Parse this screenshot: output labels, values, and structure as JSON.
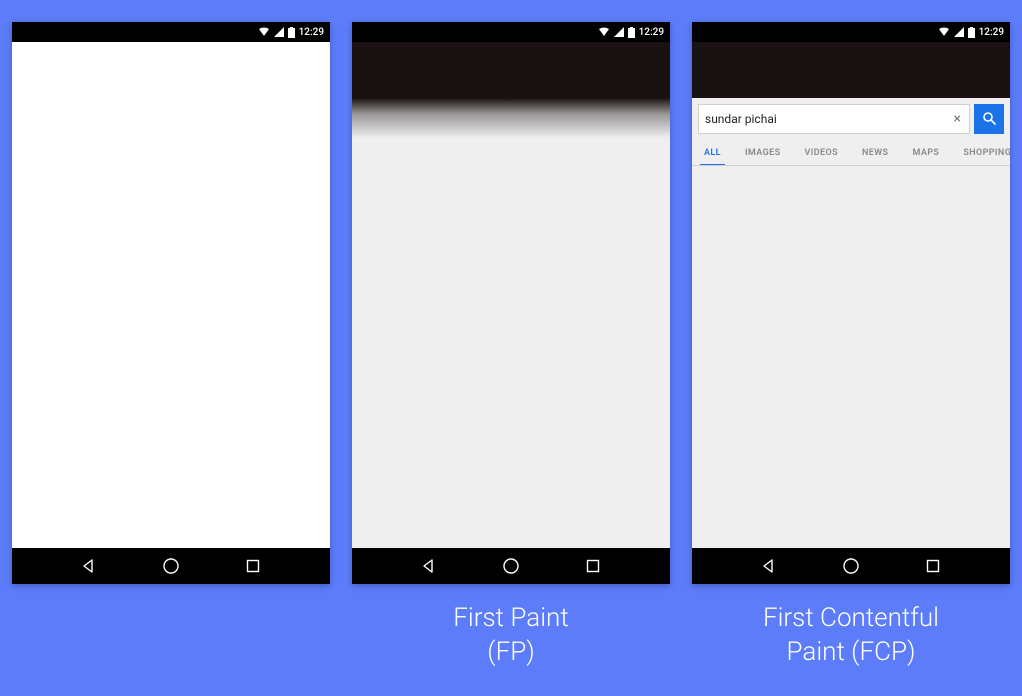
{
  "status_bar": {
    "time": "12:29"
  },
  "captions": {
    "blank": "",
    "fp_line1": "First Paint",
    "fp_line2": "(FP)",
    "fcp_line1": "First Contentful",
    "fcp_line2": "Paint (FCP)"
  },
  "search": {
    "query": "sundar pichai",
    "clear_glyph": "×"
  },
  "tabs": {
    "all": "ALL",
    "images": "IMAGES",
    "videos": "VIDEOS",
    "news": "NEWS",
    "maps": "MAPS",
    "shopping": "SHOPPING"
  }
}
